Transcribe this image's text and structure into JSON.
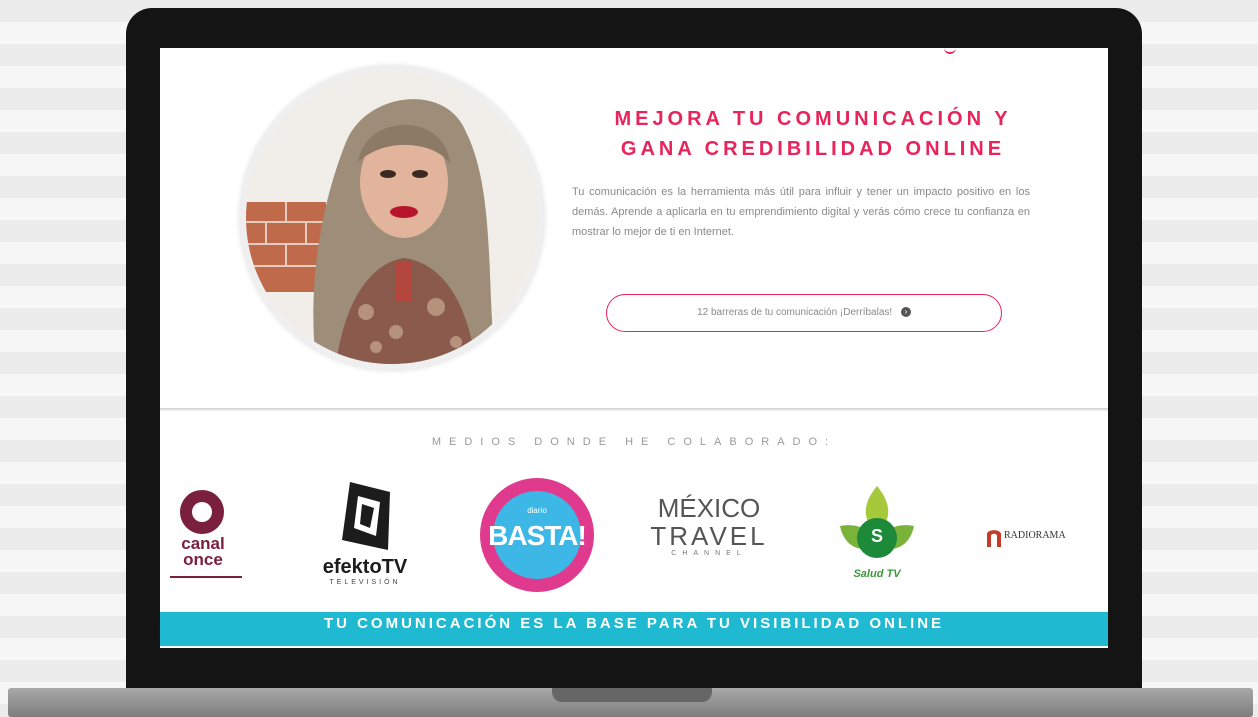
{
  "hero": {
    "headline_line1": "MEJORA TU COMUNICACIÓN Y",
    "headline_line2": "GANA CREDIBILIDAD ONLINE",
    "description": "Tu comunicación es la herramienta más útil para influir y tener un impacto positivo en los demás. Aprende a aplicarla en tu emprendimiento digital y verás cómo crece tu confianza en mostrar lo mejor de ti en Internet.",
    "cta_label": "12 barreras de tu comunicación ¡Derríbalas!"
  },
  "media": {
    "heading": "MEDIOS DONDE HE COLABORADO:",
    "logos": {
      "canal_once": "canal once",
      "efekto": "efektoTV",
      "efekto_sub": "TELEVISIÓN",
      "basta_top": "diario",
      "basta": "BASTA!",
      "mexico": "MÉXICO",
      "travel": "TRAVEL",
      "channel": "CHANNEL",
      "salud_letter": "S",
      "salud": "Salud TV",
      "radiorama": "RADIORAMA"
    }
  },
  "banner": {
    "text": "TU COMUNICACIÓN ES LA BASE PARA TU VISIBILIDAD ONLINE"
  },
  "colors": {
    "accent": "#e8245b",
    "banner": "#1fb9d1",
    "laptop": "#141414"
  }
}
